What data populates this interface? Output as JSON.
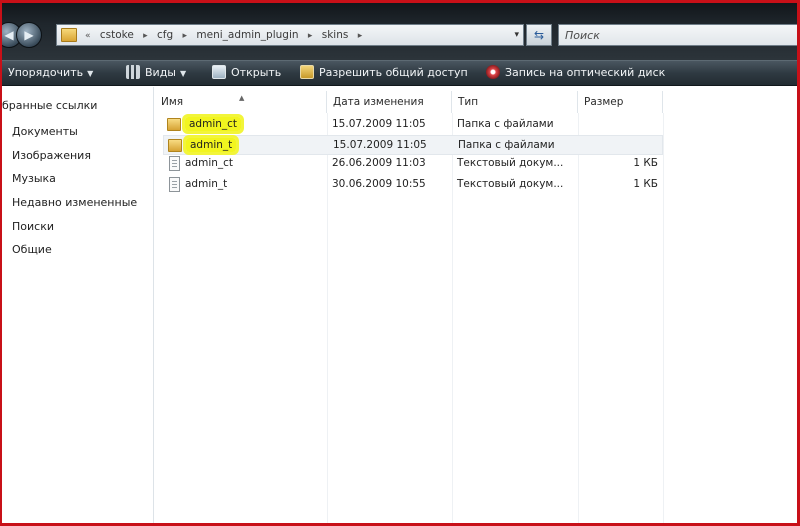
{
  "address": {
    "path": [
      "cstoke",
      "cfg",
      "meni_admin_plugin",
      "skins"
    ],
    "dropdown_glyph": "▾"
  },
  "search": {
    "placeholder": "Поиск"
  },
  "toolbar": {
    "organize_label": "Упорядочить",
    "views_label": "Виды",
    "open_label": "Открыть",
    "share_label": "Разрешить общий доступ",
    "burn_label": "Запись на оптический диск"
  },
  "nav_pane": {
    "header": "бранные ссылки",
    "links": [
      "Документы",
      "Изображения",
      "Музыка",
      "Недавно измененные",
      "Поиски",
      "Общие"
    ]
  },
  "file_list": {
    "columns": [
      "Имя",
      "Дата изменения",
      "Тип",
      "Размер"
    ],
    "rows": [
      {
        "name": "admin_ct",
        "date": "15.07.2009 11:05",
        "type": "Папка с файлами",
        "size": "",
        "kind": "folder",
        "highlighted": true
      },
      {
        "name": "admin_t",
        "date": "15.07.2009 11:05",
        "type": "Папка с файлами",
        "size": "",
        "kind": "folder",
        "highlighted": true,
        "selected": true
      },
      {
        "name": "admin_ct",
        "date": "26.06.2009 11:03",
        "type": "Текстовый докум...",
        "size": "1 КБ",
        "kind": "file"
      },
      {
        "name": "admin_t",
        "date": "30.06.2009 10:55",
        "type": "Текстовый докум...",
        "size": "1 КБ",
        "kind": "file"
      }
    ]
  },
  "colors": {
    "highlight": "#f2f51f",
    "frame": "#c81018",
    "toolbar": "#2f3a42"
  }
}
